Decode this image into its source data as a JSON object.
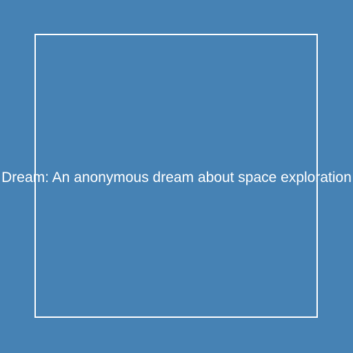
{
  "colors": {
    "background": "#4682B4",
    "frame": "#FFFFFF",
    "text": "#FFFFFF"
  },
  "dream": {
    "text": "Dream: An anonymous dream about space exploration"
  }
}
